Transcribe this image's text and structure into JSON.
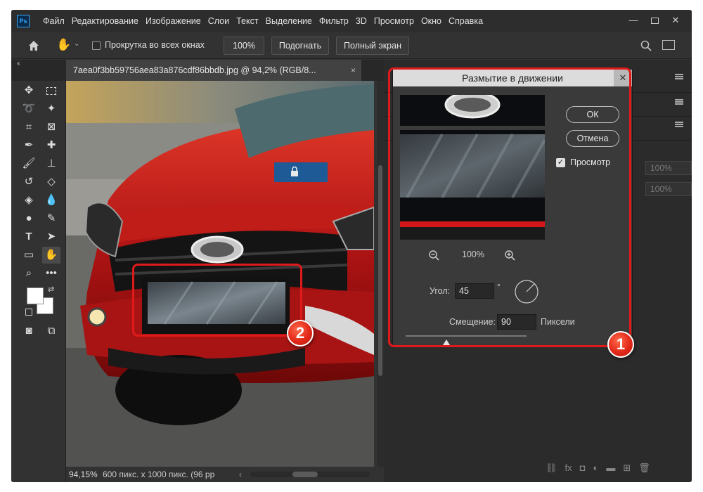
{
  "app": {
    "logo": "Ps",
    "menu": [
      "Файл",
      "Редактирование",
      "Изображение",
      "Слои",
      "Текст",
      "Выделение",
      "Фильтр",
      "3D",
      "Просмотр",
      "Окно",
      "Справка"
    ]
  },
  "window_controls": {
    "minimize": "—",
    "close": "✕"
  },
  "options_bar": {
    "scroll_all_label": "Прокрутка во всех окнах",
    "zoom_button": "100%",
    "fit_button": "Подогнать",
    "fullscreen_button": "Полный экран"
  },
  "document_tab": {
    "title": "7aea0f3bb59756aea83a876cdf86bbdb.jpg @ 94,2% (RGB/8...",
    "close": "×"
  },
  "status_bar": {
    "zoom": "94,15%",
    "doc_info": "600 пикс. x 1000 пикс. (96 pp",
    "arrow": "‹"
  },
  "panels": {
    "opacity_value": "100%",
    "fill_value": "100%"
  },
  "dialog": {
    "title": "Размытие в движении",
    "close": "✕",
    "ok_button": "ОК",
    "cancel_button": "Отмена",
    "preview_label": "Просмотр",
    "preview_checked": true,
    "zoom_value": "100%",
    "angle_label": "Угол:",
    "angle_value": "45",
    "degree_symbol": "°",
    "distance_label": "Смещение:",
    "distance_value": "90",
    "distance_unit": "Пиксели",
    "distance_slider_fraction": 0.34
  },
  "annotations": {
    "badge_1": "1",
    "badge_2": "2",
    "color": "#e01a1a"
  },
  "icons": {
    "home": "home-icon",
    "hand": "hand-icon",
    "search": "search-icon",
    "zoom_in": "zoom-in-icon",
    "zoom_out": "zoom-out-icon",
    "lock": "lock-icon"
  }
}
